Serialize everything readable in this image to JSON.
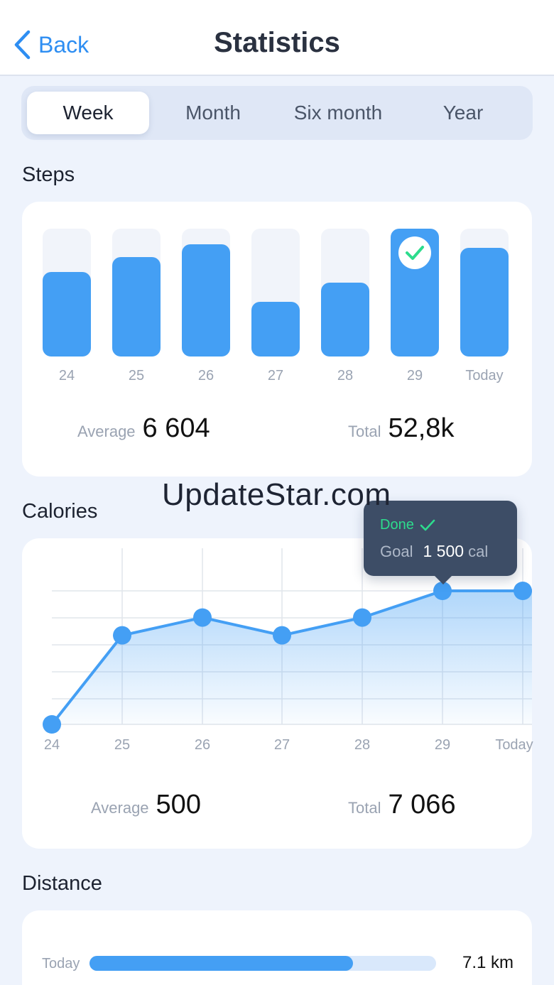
{
  "header": {
    "back_label": "Back",
    "title": "Statistics"
  },
  "periods": [
    "Week",
    "Month",
    "Six month",
    "Year"
  ],
  "active_period": 0,
  "steps": {
    "title": "Steps",
    "days": [
      "24",
      "25",
      "26",
      "27",
      "28",
      "29",
      "Today"
    ],
    "fill_fraction": [
      0.66,
      0.78,
      0.88,
      0.43,
      0.58,
      1.0,
      0.85
    ],
    "goal_met_index": 5,
    "average_label": "Average",
    "average_value": "6 604",
    "total_label": "Total",
    "total_value": "52,8k",
    "colors": {
      "bar": "#449ff4",
      "track": "#f1f4fa",
      "check": "#2ddc8d"
    }
  },
  "calories": {
    "title": "Calories",
    "chart_data": {
      "type": "area",
      "x": [
        "24",
        "25",
        "26",
        "27",
        "28",
        "29",
        "Today"
      ],
      "values": [
        0,
        1000,
        1200,
        1000,
        1200,
        1500,
        1500
      ],
      "ylim": [
        0,
        1500
      ],
      "grid": true,
      "title": "",
      "xlabel": "",
      "ylabel": ""
    },
    "tooltip": {
      "status": "Done",
      "goal_label": "Goal",
      "goal_value": "1 500",
      "goal_unit": "cal"
    },
    "average_label": "Average",
    "average_value": "500",
    "total_label": "Total",
    "total_value": "7 066",
    "colors": {
      "line": "#449ff4",
      "status": "#2ddc8d"
    }
  },
  "distance": {
    "title": "Distance",
    "rows": [
      {
        "label": "Today",
        "fraction": 0.76,
        "value": "7.1 km"
      }
    ]
  },
  "watermark": "UpdateStar.com"
}
